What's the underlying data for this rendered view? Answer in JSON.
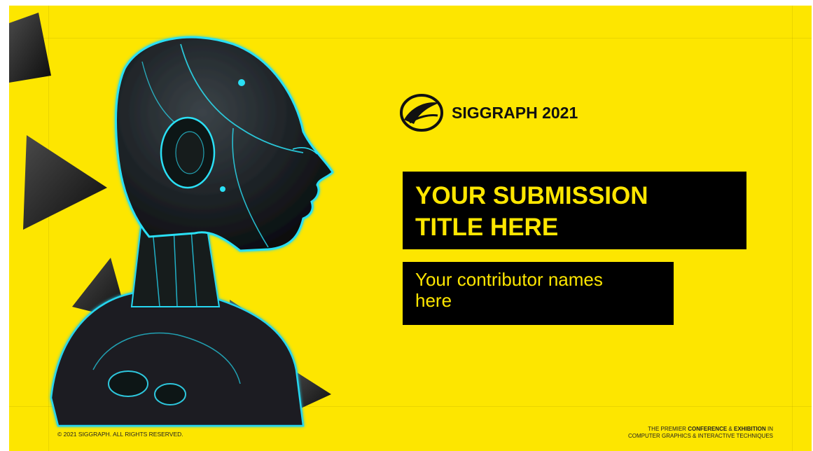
{
  "slide": {
    "background_color": "#fde600",
    "accent_color": "#000000",
    "illustration": "robot-head-illustration"
  },
  "logo": {
    "icon": "siggraph-logo-icon",
    "text": "SIGGRAPH 2021"
  },
  "title": {
    "line1": "YOUR SUBMISSION",
    "line2": "TITLE HERE"
  },
  "contributors": {
    "line1": "Your contributor names",
    "line2": "here"
  },
  "footer": {
    "copyright": "© 2021 SIGGRAPH. ALL RIGHTS RESERVED.",
    "tagline_part1": "THE PREMIER ",
    "tagline_bold1": "CONFERENCE",
    "tagline_part2": " & ",
    "tagline_bold2": "EXHIBITION",
    "tagline_part3": " IN",
    "tagline_line2": "COMPUTER GRAPHICS & INTERACTIVE TECHNIQUES"
  }
}
